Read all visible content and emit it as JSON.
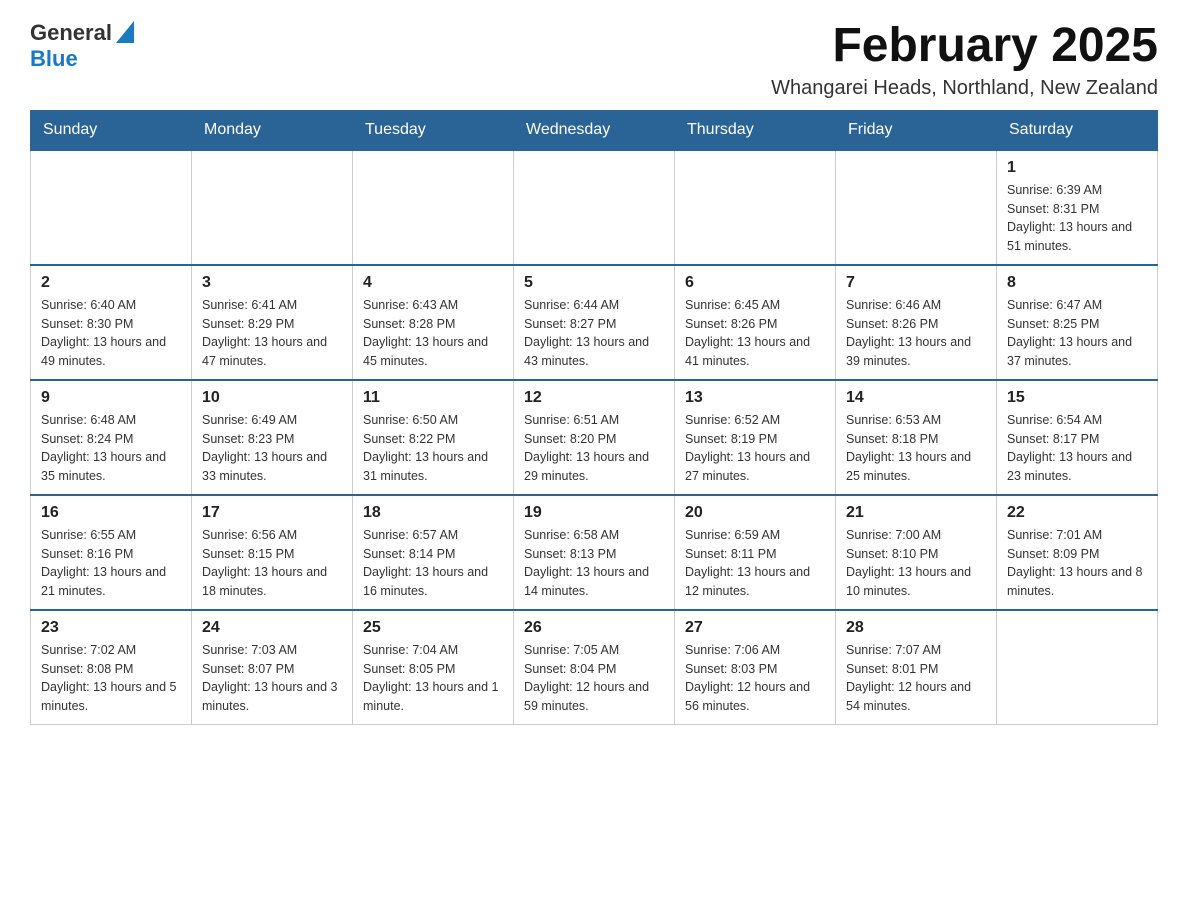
{
  "header": {
    "logo_general": "General",
    "logo_blue": "Blue",
    "month_title": "February 2025",
    "location": "Whangarei Heads, Northland, New Zealand"
  },
  "days_of_week": [
    "Sunday",
    "Monday",
    "Tuesday",
    "Wednesday",
    "Thursday",
    "Friday",
    "Saturday"
  ],
  "weeks": [
    [
      {
        "day": "",
        "info": ""
      },
      {
        "day": "",
        "info": ""
      },
      {
        "day": "",
        "info": ""
      },
      {
        "day": "",
        "info": ""
      },
      {
        "day": "",
        "info": ""
      },
      {
        "day": "",
        "info": ""
      },
      {
        "day": "1",
        "info": "Sunrise: 6:39 AM\nSunset: 8:31 PM\nDaylight: 13 hours and 51 minutes."
      }
    ],
    [
      {
        "day": "2",
        "info": "Sunrise: 6:40 AM\nSunset: 8:30 PM\nDaylight: 13 hours and 49 minutes."
      },
      {
        "day": "3",
        "info": "Sunrise: 6:41 AM\nSunset: 8:29 PM\nDaylight: 13 hours and 47 minutes."
      },
      {
        "day": "4",
        "info": "Sunrise: 6:43 AM\nSunset: 8:28 PM\nDaylight: 13 hours and 45 minutes."
      },
      {
        "day": "5",
        "info": "Sunrise: 6:44 AM\nSunset: 8:27 PM\nDaylight: 13 hours and 43 minutes."
      },
      {
        "day": "6",
        "info": "Sunrise: 6:45 AM\nSunset: 8:26 PM\nDaylight: 13 hours and 41 minutes."
      },
      {
        "day": "7",
        "info": "Sunrise: 6:46 AM\nSunset: 8:26 PM\nDaylight: 13 hours and 39 minutes."
      },
      {
        "day": "8",
        "info": "Sunrise: 6:47 AM\nSunset: 8:25 PM\nDaylight: 13 hours and 37 minutes."
      }
    ],
    [
      {
        "day": "9",
        "info": "Sunrise: 6:48 AM\nSunset: 8:24 PM\nDaylight: 13 hours and 35 minutes."
      },
      {
        "day": "10",
        "info": "Sunrise: 6:49 AM\nSunset: 8:23 PM\nDaylight: 13 hours and 33 minutes."
      },
      {
        "day": "11",
        "info": "Sunrise: 6:50 AM\nSunset: 8:22 PM\nDaylight: 13 hours and 31 minutes."
      },
      {
        "day": "12",
        "info": "Sunrise: 6:51 AM\nSunset: 8:20 PM\nDaylight: 13 hours and 29 minutes."
      },
      {
        "day": "13",
        "info": "Sunrise: 6:52 AM\nSunset: 8:19 PM\nDaylight: 13 hours and 27 minutes."
      },
      {
        "day": "14",
        "info": "Sunrise: 6:53 AM\nSunset: 8:18 PM\nDaylight: 13 hours and 25 minutes."
      },
      {
        "day": "15",
        "info": "Sunrise: 6:54 AM\nSunset: 8:17 PM\nDaylight: 13 hours and 23 minutes."
      }
    ],
    [
      {
        "day": "16",
        "info": "Sunrise: 6:55 AM\nSunset: 8:16 PM\nDaylight: 13 hours and 21 minutes."
      },
      {
        "day": "17",
        "info": "Sunrise: 6:56 AM\nSunset: 8:15 PM\nDaylight: 13 hours and 18 minutes."
      },
      {
        "day": "18",
        "info": "Sunrise: 6:57 AM\nSunset: 8:14 PM\nDaylight: 13 hours and 16 minutes."
      },
      {
        "day": "19",
        "info": "Sunrise: 6:58 AM\nSunset: 8:13 PM\nDaylight: 13 hours and 14 minutes."
      },
      {
        "day": "20",
        "info": "Sunrise: 6:59 AM\nSunset: 8:11 PM\nDaylight: 13 hours and 12 minutes."
      },
      {
        "day": "21",
        "info": "Sunrise: 7:00 AM\nSunset: 8:10 PM\nDaylight: 13 hours and 10 minutes."
      },
      {
        "day": "22",
        "info": "Sunrise: 7:01 AM\nSunset: 8:09 PM\nDaylight: 13 hours and 8 minutes."
      }
    ],
    [
      {
        "day": "23",
        "info": "Sunrise: 7:02 AM\nSunset: 8:08 PM\nDaylight: 13 hours and 5 minutes."
      },
      {
        "day": "24",
        "info": "Sunrise: 7:03 AM\nSunset: 8:07 PM\nDaylight: 13 hours and 3 minutes."
      },
      {
        "day": "25",
        "info": "Sunrise: 7:04 AM\nSunset: 8:05 PM\nDaylight: 13 hours and 1 minute."
      },
      {
        "day": "26",
        "info": "Sunrise: 7:05 AM\nSunset: 8:04 PM\nDaylight: 12 hours and 59 minutes."
      },
      {
        "day": "27",
        "info": "Sunrise: 7:06 AM\nSunset: 8:03 PM\nDaylight: 12 hours and 56 minutes."
      },
      {
        "day": "28",
        "info": "Sunrise: 7:07 AM\nSunset: 8:01 PM\nDaylight: 12 hours and 54 minutes."
      },
      {
        "day": "",
        "info": ""
      }
    ]
  ]
}
